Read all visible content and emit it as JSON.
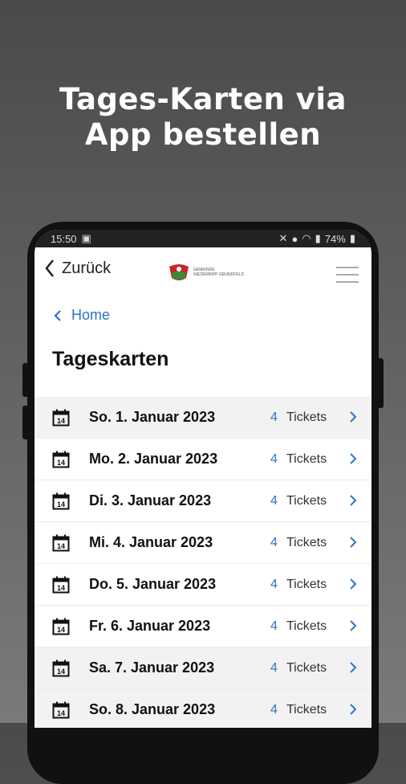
{
  "promo": {
    "line1": "Tages-Karten via",
    "line2": "App bestellen"
  },
  "statusbar": {
    "time": "15:50",
    "battery": "74%"
  },
  "header": {
    "back_label": "Zurück",
    "logo_text_line1": "GEMEINDE",
    "logo_text_line2": "NIEDERBIPP·GRUNDFELD"
  },
  "breadcrumb": {
    "home_label": "Home"
  },
  "page": {
    "title": "Tageskarten"
  },
  "colors": {
    "accent": "#2a74c9",
    "row_highlight": "#f2f2f2"
  },
  "rows": [
    {
      "date": "So. 1. Januar 2023",
      "count": "4",
      "tickets": "Tickets"
    },
    {
      "date": "Mo. 2. Januar 2023",
      "count": "4",
      "tickets": "Tickets"
    },
    {
      "date": "Di. 3. Januar 2023",
      "count": "4",
      "tickets": "Tickets"
    },
    {
      "date": "Mi. 4. Januar 2023",
      "count": "4",
      "tickets": "Tickets"
    },
    {
      "date": "Do. 5. Januar 2023",
      "count": "4",
      "tickets": "Tickets"
    },
    {
      "date": "Fr. 6. Januar 2023",
      "count": "4",
      "tickets": "Tickets"
    },
    {
      "date": "Sa. 7. Januar 2023",
      "count": "4",
      "tickets": "Tickets"
    },
    {
      "date": "So. 8. Januar 2023",
      "count": "4",
      "tickets": "Tickets"
    }
  ],
  "calendar_day": "14"
}
